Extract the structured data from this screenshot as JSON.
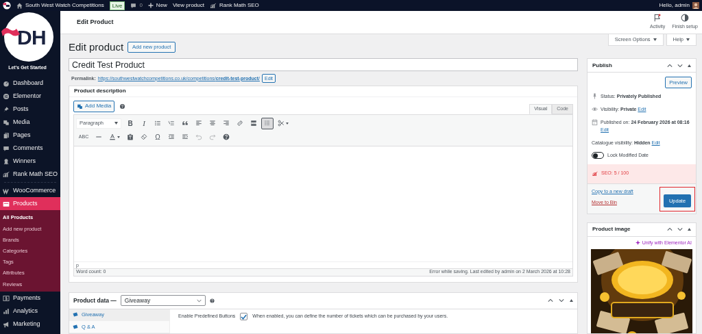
{
  "admin_bar": {
    "site": "South West Watch Competitions",
    "badge": "Live",
    "comments": "0",
    "new": "New",
    "view": "View product",
    "seo": "Rank Math SEO",
    "greeting": "Hello, admin"
  },
  "header": {
    "title": "Edit Product",
    "actions": [
      {
        "kind": "flag",
        "label": "Activity"
      },
      {
        "kind": "half",
        "label": "Finish setup"
      }
    ]
  },
  "screen_tabs": [
    "Screen Options",
    "Help"
  ],
  "sidebar": {
    "logo": "DH",
    "tagline": "Let's Get Started",
    "items": [
      {
        "label": "Dashboard",
        "selected": false
      },
      {
        "label": "Elementor",
        "selected": false
      },
      {
        "label": "Posts",
        "selected": false
      },
      {
        "label": "Media",
        "selected": false
      },
      {
        "label": "Pages",
        "selected": false
      },
      {
        "label": "Comments",
        "selected": false
      },
      {
        "label": "Winners",
        "selected": false
      },
      {
        "label": "Rank Math SEO",
        "selected": false
      },
      {
        "label": "WooCommerce",
        "selected": false
      },
      {
        "label": "Products",
        "selected": true,
        "children": [
          {
            "label": "All Products",
            "selected": true
          },
          {
            "label": "Add new product",
            "selected": false
          },
          {
            "label": "Brands",
            "selected": false
          },
          {
            "label": "Categories",
            "selected": false
          },
          {
            "label": "Tags",
            "selected": false
          },
          {
            "label": "Attributes",
            "selected": false
          },
          {
            "label": "Reviews",
            "selected": false
          }
        ]
      },
      {
        "label": "Payments",
        "selected": false
      },
      {
        "label": "Analytics",
        "selected": false
      },
      {
        "label": "Marketing",
        "selected": false
      }
    ]
  },
  "page": {
    "heading": "Edit product",
    "add_button": "Add new product",
    "title_value": "Credit Test Product",
    "permalink_label": "Permalink:",
    "permalink": "https://southwestwatchcompetitions.co.uk/competitions/**credit-test-product**/",
    "permalink_edit": "Edit"
  },
  "description": {
    "title": "Product description",
    "add_media": "Add Media",
    "editor_tabs": [
      {
        "label": "Visual",
        "selected": true
      },
      {
        "label": "Code",
        "selected": false
      }
    ],
    "toolbar": [
      [
        {
          "kind": "select",
          "label": "Paragraph"
        },
        {
          "kind": "bold",
          "glyph": "B"
        },
        {
          "kind": "italic",
          "glyph": "I"
        },
        {
          "kind": "ul"
        },
        {
          "kind": "ol"
        },
        {
          "kind": "quote"
        },
        {
          "kind": "align-left"
        },
        {
          "kind": "align-center"
        },
        {
          "kind": "align-right"
        },
        {
          "kind": "link"
        },
        {
          "kind": "more"
        },
        {
          "kind": "toggle",
          "pressed": true
        },
        {
          "kind": "scissors"
        }
      ],
      [
        {
          "kind": "strike",
          "glyph": "ABC"
        },
        {
          "kind": "hr"
        },
        {
          "kind": "color"
        },
        {
          "kind": "paste"
        },
        {
          "kind": "eraser"
        },
        {
          "kind": "symbol",
          "glyph": "Ω"
        },
        {
          "kind": "outdent"
        },
        {
          "kind": "indent"
        },
        {
          "kind": "undo"
        },
        {
          "kind": "redo"
        },
        {
          "kind": "help"
        }
      ]
    ],
    "path": "p",
    "word_count": "Word count: 0",
    "status": "Error while saving. Last edited by admin on 2 March 2026 at 10:28"
  },
  "product_data": {
    "label": "Product data —",
    "type": "Giveaway",
    "tabs": [
      {
        "label": "Giveaway",
        "selected": true
      },
      {
        "label": "Q & A",
        "selected": false
      }
    ],
    "field": {
      "label": "Enable Predefined Buttons",
      "checked": true,
      "description": "When enabled, you can define the number of tickets which can be purchased by your users."
    }
  },
  "publish": {
    "title": "Publish",
    "preview": "Preview",
    "rows": [
      {
        "kind": "status",
        "text": "Status: **Privately Published**"
      },
      {
        "kind": "visibility",
        "text": "Visibility: **Private**",
        "edit": "Edit"
      },
      {
        "kind": "date",
        "text": "Published on: **24 February 2026 at 08:16**",
        "edit": "Edit"
      },
      {
        "kind": "catalogue",
        "text": "Catalogue visibility: **Hidden**",
        "edit": "Edit"
      }
    ],
    "lock": {
      "label": "Lock Modified Date",
      "on": false
    },
    "seo": "SEO: 5 / 100",
    "copy": "Copy to a new draft",
    "bin": "Move to Bin",
    "update": "Update",
    "update_highlighted": true
  },
  "product_image": {
    "title": "Product image",
    "ai_link": "Unify with Elementor AI"
  }
}
